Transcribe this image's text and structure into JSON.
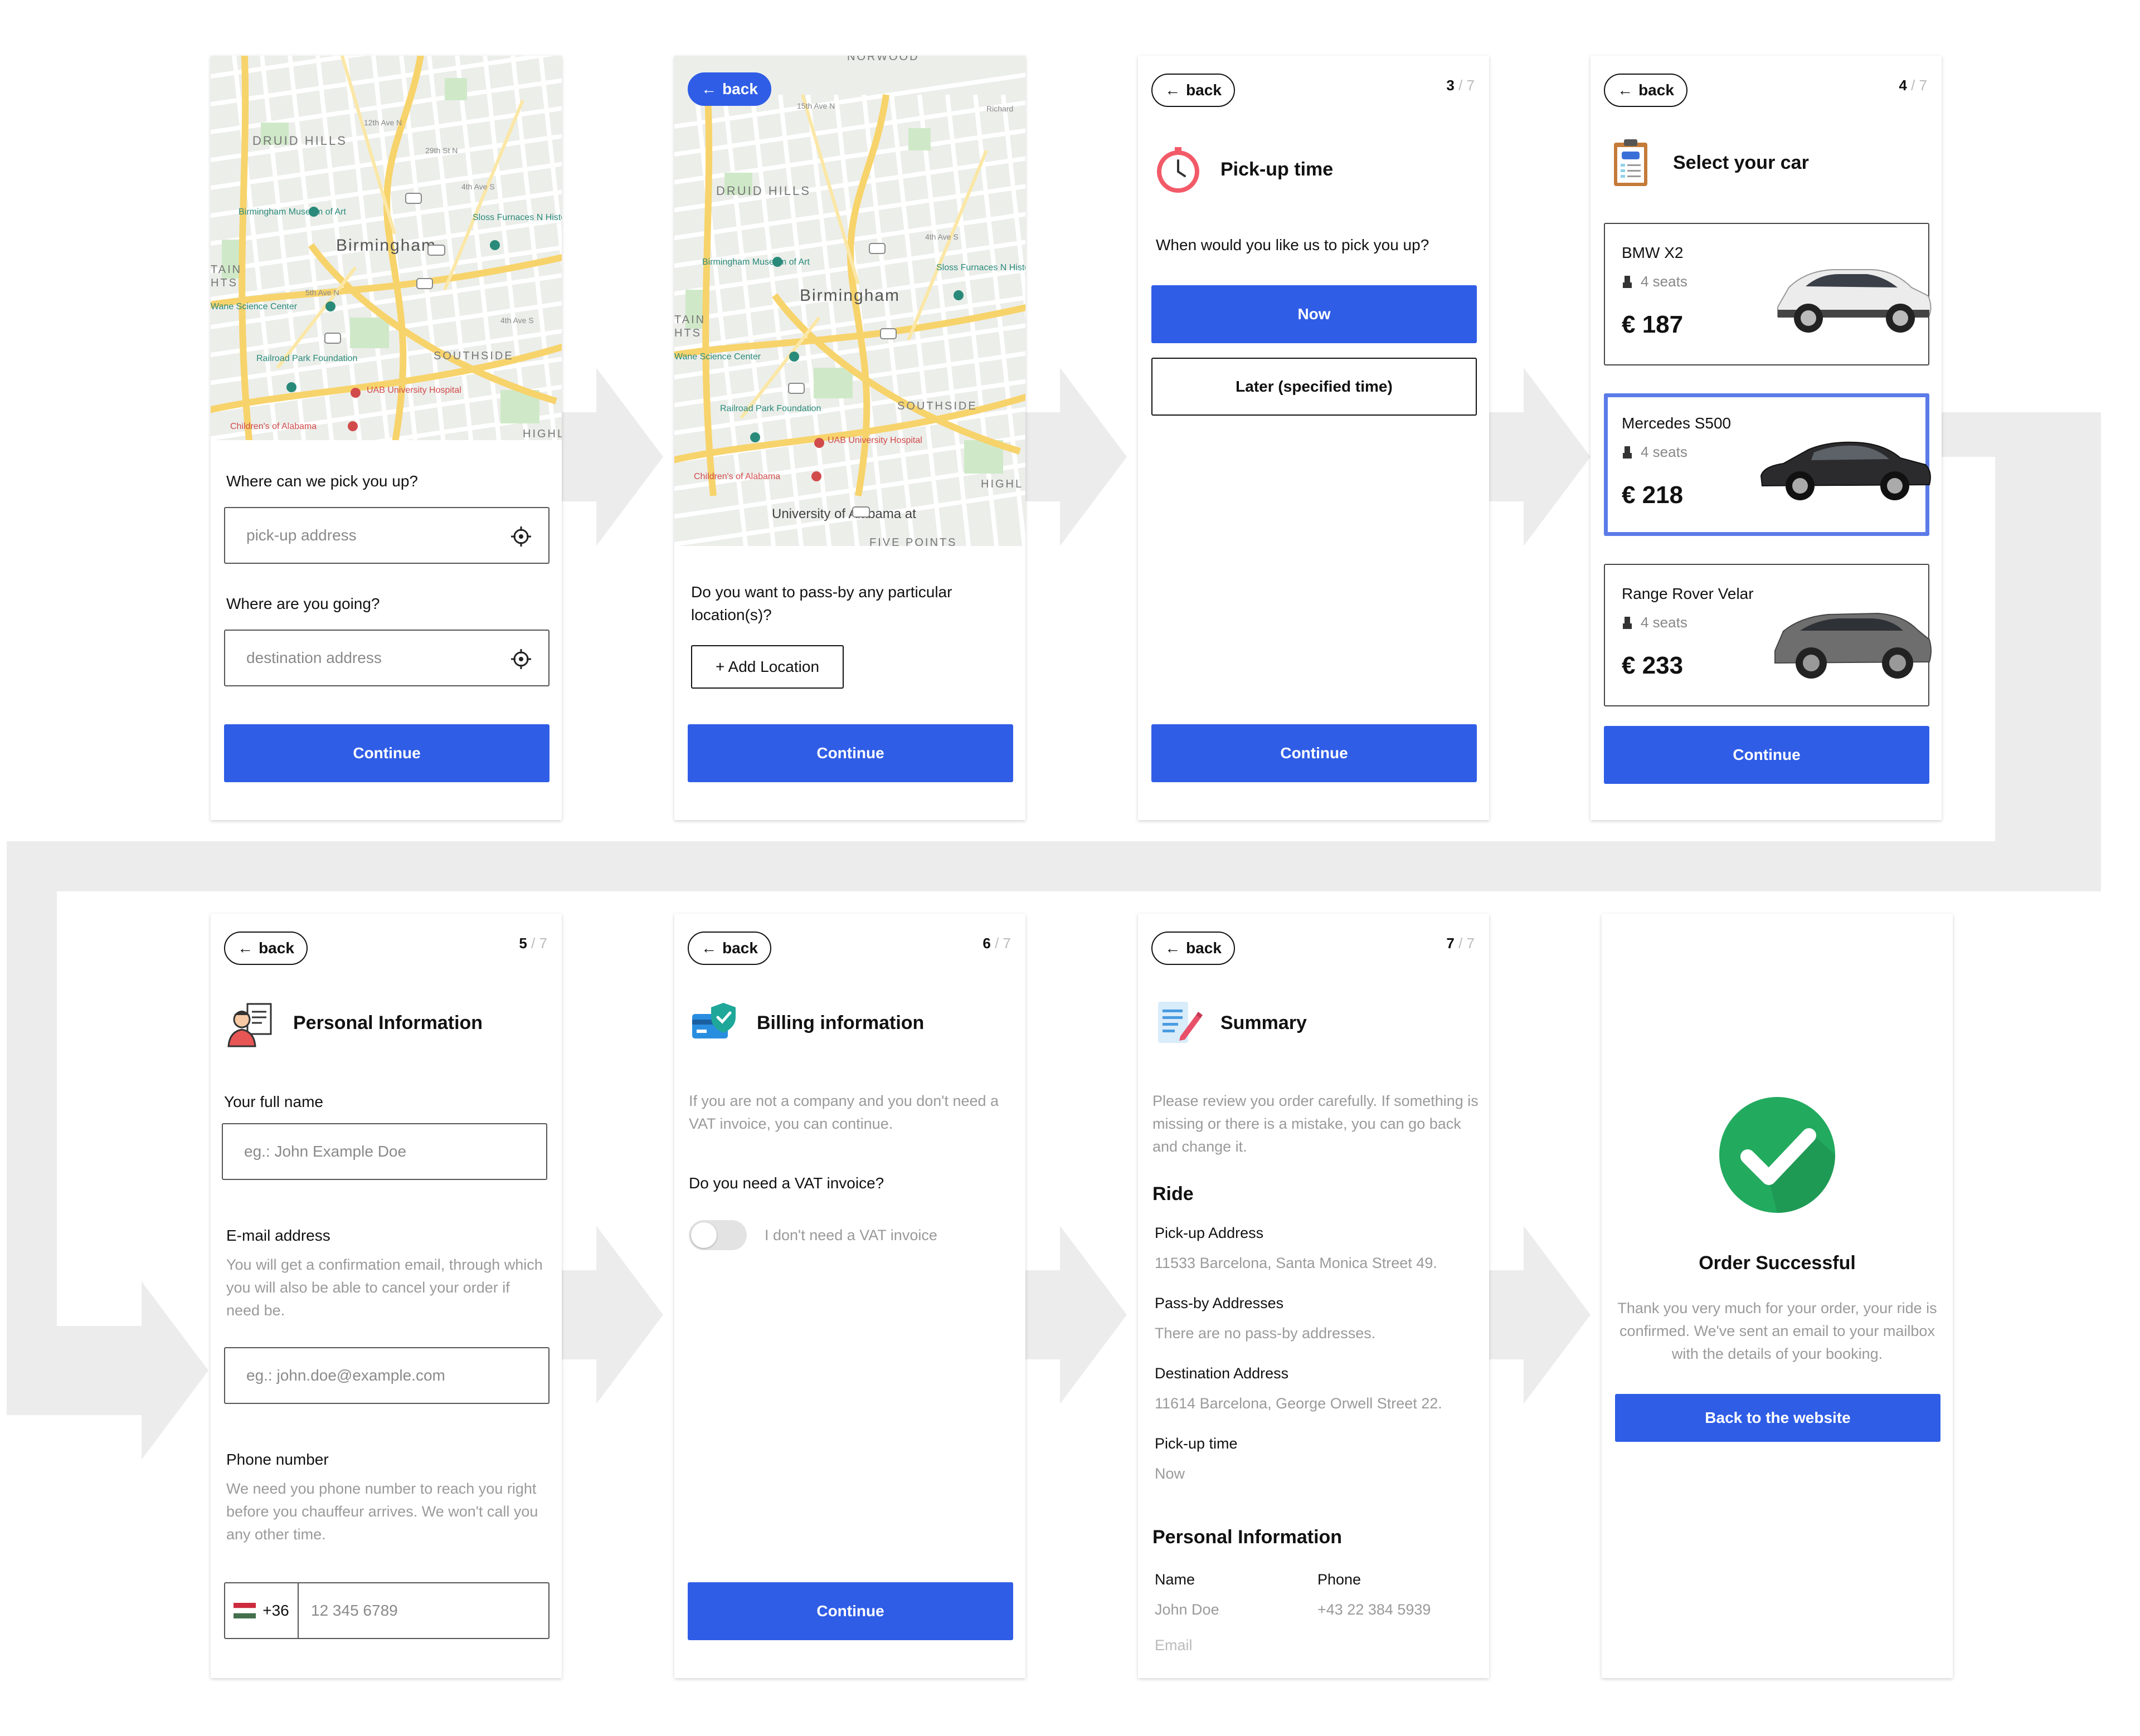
{
  "colors": {
    "primary": "#2f5de6",
    "selected_border": "#5b7be8",
    "muted_text": "#9a9a9a",
    "success_green": "#22aa5e",
    "flow_arrows": "#ececec"
  },
  "map_labels": {
    "druid_hills": "DRUID HILLS",
    "birmingham": "Birmingham",
    "birmingham_museum": "Birmingham Museum of Art",
    "sloss": "Sloss Furnaces N Historic Landmark",
    "mcwane": "Wane Science Center",
    "railroad": "Railroad Park Foundation",
    "uab": "UAB University Hospital",
    "childrens": "Children's of Alabama",
    "southside": "SOUTHSIDE",
    "highland": "HIGHL",
    "mountain": "TAIN",
    "heights": "HTS",
    "norwood": "NORWOOD",
    "univ_alabama": "University of Alabama at",
    "five_points": "FIVE POINTS",
    "streets": [
      "12th Ave N",
      "29th St N",
      "26th St N",
      "31st St N",
      "15th Ave N",
      "5th Ave N",
      "4th Ave S",
      "F L Shuttlesworth Dr",
      "Messer Airport Hwy",
      "Richard",
      "20th St S",
      "4th Ave S"
    ],
    "shields": [
      "20",
      "280",
      "11",
      "78",
      "280",
      "149"
    ]
  },
  "screen1": {
    "pickup_question": "Where can we pick you up?",
    "pickup_placeholder": "pick-up address",
    "destination_question": "Where are you going?",
    "destination_placeholder": "destination address",
    "continue": "Continue",
    "location_icon": "crosshair-icon"
  },
  "screen2": {
    "back": "back",
    "question": "Do you want to pass-by any particular location(s)?",
    "add_location": "+ Add Location",
    "continue": "Continue"
  },
  "screen3": {
    "back": "back",
    "step": "3",
    "total": "/ 7",
    "title": "Pick-up time",
    "question": "When would you like us to pick you up?",
    "now": "Now",
    "later": "Later (specified time)",
    "continue": "Continue",
    "icon": "clock-icon"
  },
  "screen4": {
    "back": "back",
    "step": "4",
    "total": "/ 7",
    "title": "Select your car",
    "icon": "clipboard-icon",
    "cars": [
      {
        "name": "BMW X2",
        "seats": "4 seats",
        "price": "€ 187",
        "color": "#e8e8e8"
      },
      {
        "name": "Mercedes S500",
        "seats": "4 seats",
        "price": "€ 218",
        "color": "#2a2a2c"
      },
      {
        "name": "Range Rover Velar",
        "seats": "4 seats",
        "price": "€ 233",
        "color": "#6e6e6e"
      }
    ],
    "selected_index": 1,
    "continue": "Continue"
  },
  "screen5": {
    "back": "back",
    "step": "5",
    "total": "/ 7",
    "title": "Personal Information",
    "icon": "person-document-icon",
    "name_label": "Your full name",
    "name_placeholder": "eg.: John Example Doe",
    "email_label": "E-mail address",
    "email_help": "You will get a confirmation email, through which you will also be able to cancel your order if need be.",
    "email_placeholder": "eg.: john.doe@example.com",
    "phone_label": "Phone number",
    "phone_help": "We need you phone number to reach you right before you chauffeur arrives. We won't call you any other time.",
    "country_code": "+36",
    "phone_placeholder": "12 345 6789"
  },
  "screen6": {
    "back": "back",
    "step": "6",
    "total": "/ 7",
    "title": "Billing information",
    "icon": "card-shield-icon",
    "help": "If you are not a company and you don't need a VAT invoice, you can continue.",
    "question": "Do you need a VAT invoice?",
    "toggle_label": "I don't need a VAT invoice",
    "vat_needed": false,
    "continue": "Continue"
  },
  "screen7": {
    "back": "back",
    "step": "7",
    "total": "/ 7",
    "title": "Summary",
    "icon": "document-pen-icon",
    "help": "Please review you order carefully. If something is missing or there is a mistake, you can go back and change it.",
    "ride_heading": "Ride",
    "pickup_label": "Pick-up Address",
    "pickup_value": "11533 Barcelona, Santa Monica Street 49.",
    "passby_label": "Pass-by Addresses",
    "passby_value": "There are no pass-by addresses.",
    "destination_label": "Destination Address",
    "destination_value": "11614 Barcelona, George Orwell Street 22.",
    "time_label": "Pick-up time",
    "time_value": "Now",
    "personal_heading": "Personal Information",
    "name_label": "Name",
    "name_value": "John Doe",
    "phone_label": "Phone",
    "phone_value": "+43 22 384 5939",
    "email_label": "Email"
  },
  "screen8": {
    "icon": "check-circle-icon",
    "title": "Order Successful",
    "text": "Thank you very much for your order, your ride is confirmed. We've sent an email to your mailbox with the details of your booking.",
    "button": "Back to the website"
  }
}
